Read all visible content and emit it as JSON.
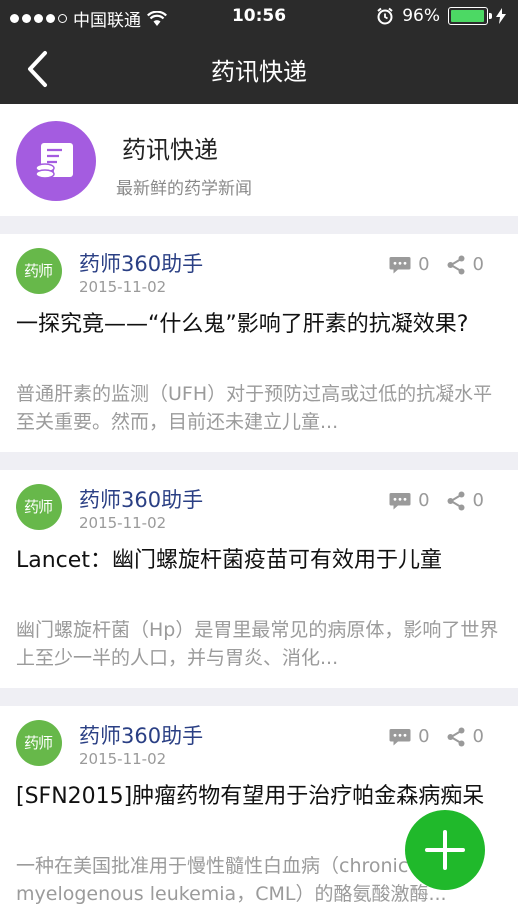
{
  "status_bar": {
    "carrier": "中国联通",
    "time": "10:56",
    "battery_percent": "96%",
    "battery_level": 0.96,
    "battery_color": "#4cd964",
    "icons": [
      "signal-dots-icon",
      "wifi-icon",
      "alarm-icon",
      "battery-icon"
    ]
  },
  "nav": {
    "title": "药讯快递",
    "back_icon": "chevron-left-icon"
  },
  "channel": {
    "title": "药讯快递",
    "subtitle": "最新鲜的药学新闻",
    "logo_icon": "document-coin-icon",
    "logo_color": "#a45ce0"
  },
  "articles": [
    {
      "author": "药师360助手",
      "avatar_text": "药师",
      "date": "2015-11-02",
      "comments": "0",
      "shares": "0",
      "title": "一探究竟——“什么鬼”影响了肝素的抗凝效果?",
      "summary": "普通肝素的监测（UFH）对于预防过高或过低的抗凝水平至关重要。然而，目前还未建立儿童..."
    },
    {
      "author": "药师360助手",
      "avatar_text": "药师",
      "date": "2015-11-02",
      "comments": "0",
      "shares": "0",
      "title": "Lancet：幽门螺旋杆菌疫苗可有效用于儿童",
      "summary": "幽门螺旋杆菌（Hp）是胃里最常见的病原体，影响了世界上至少一半的人口，并与胃炎、消化..."
    },
    {
      "author": "药师360助手",
      "avatar_text": "药师",
      "date": "2015-11-02",
      "comments": "0",
      "shares": "0",
      "title": "[SFN2015]肿瘤药物有望用于治疗帕金森病痴呆",
      "summary": "一种在美国批准用于慢性髓性白血病（chronic myelogenous leukemia，CML）的酪氨酸激酶..."
    }
  ],
  "fab": {
    "icon": "plus-icon",
    "color": "#20b92b"
  },
  "colors": {
    "bar_bg": "#2b2b2b",
    "author_blue": "#2a3f84",
    "avatar_green": "#67b84a"
  }
}
